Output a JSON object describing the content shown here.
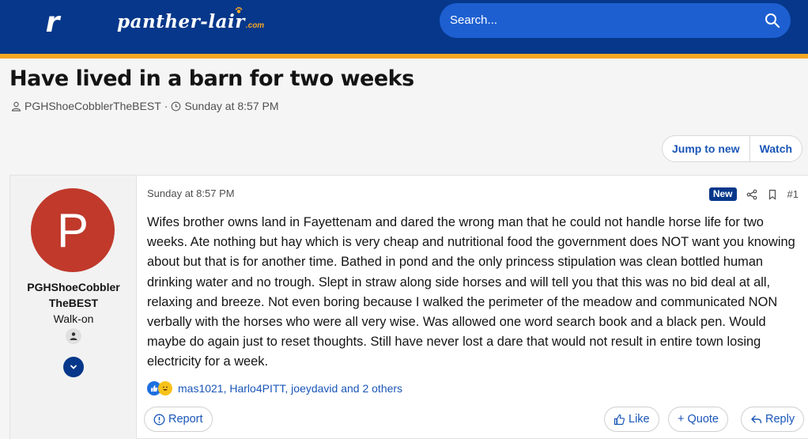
{
  "header": {
    "logo_letter": "r",
    "brand_name": "panther-lair",
    "brand_suffix": ".com",
    "search_placeholder": "Search...",
    "colors": {
      "header_bg": "#06378a",
      "accent_stripe": "#f5a623",
      "search_bg": "#1d5fd1"
    }
  },
  "thread": {
    "title": "Have lived in a barn for two weeks",
    "author": "PGHShoeCobblerTheBEST",
    "separator": "·",
    "started": "Sunday at 8:57 PM",
    "jump_label": "Jump to new",
    "watch_label": "Watch"
  },
  "post": {
    "user": {
      "avatar_letter": "P",
      "avatar_color": "#c0392b",
      "name_line1": "PGHShoeCobbler",
      "name_line2": "TheBEST",
      "user_title": "Walk-on"
    },
    "date": "Sunday at 8:57 PM",
    "new_label": "New",
    "number": "#1",
    "body": "Wifes brother owns land in Fayettenam and dared the wrong man that he could not handle horse life for two weeks. Ate nothing but hay which is very cheap and nutritional food the government does NOT want you knowing about but that is for another time. Bathed in pond and the only princess stipulation was clean bottled human drinking water and no trough. Slept in straw along side horses and will tell you that this was no bid deal at all, relaxing and breeze. Not even boring because I walked the perimeter of the meadow and communicated NON verbally with the horses who were all very wise. Was allowed one word search book and a black pen. Would maybe do again just to reset thoughts. Still have never lost a dare that would not result in entire town losing electricity for a week.",
    "reactions_text": "mas1021, Harlo4PITT, joeydavid and 2 others",
    "report_label": "Report",
    "like_label": "Like",
    "quote_label": "+ Quote",
    "reply_label": "Reply"
  }
}
